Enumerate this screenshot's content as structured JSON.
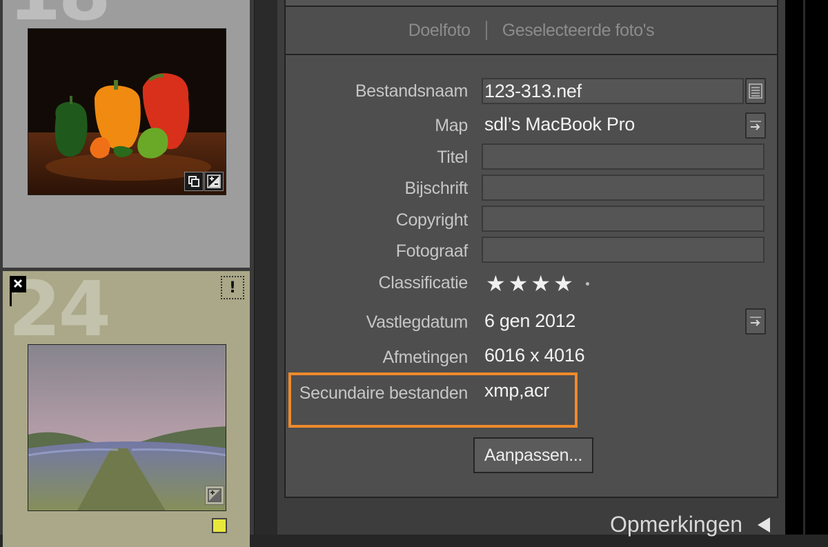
{
  "grid": {
    "cells": [
      {
        "number": "18"
      },
      {
        "number": "24",
        "color_label": "#e8e83c"
      }
    ]
  },
  "metadata_panel": {
    "tabs": [
      {
        "label": "Doelfoto"
      },
      {
        "label": "Geselecteerde foto's"
      }
    ],
    "fields": {
      "filename": {
        "label": "Bestandsnaam",
        "value": "123-313.nef"
      },
      "folder": {
        "label": "Map",
        "value": "sdl’s MacBook Pro"
      },
      "title": {
        "label": "Titel",
        "value": ""
      },
      "caption": {
        "label": "Bijschrift",
        "value": ""
      },
      "copyright": {
        "label": "Copyright",
        "value": ""
      },
      "creator": {
        "label": "Fotograaf",
        "value": ""
      },
      "rating": {
        "label": "Classificatie",
        "stars": 4,
        "max": 5
      },
      "capture_date": {
        "label": "Vastlegdatum",
        "value": "6 gen 2012"
      },
      "dimensions": {
        "label": "Afmetingen",
        "value": "6016 x 4016"
      },
      "sidecar": {
        "label": "Secundaire bestanden",
        "value": "xmp,acr"
      }
    },
    "edit_button": "Aanpassen...",
    "highlight_color": "#f08a2c"
  },
  "comments_panel": {
    "title": "Opmerkingen"
  }
}
